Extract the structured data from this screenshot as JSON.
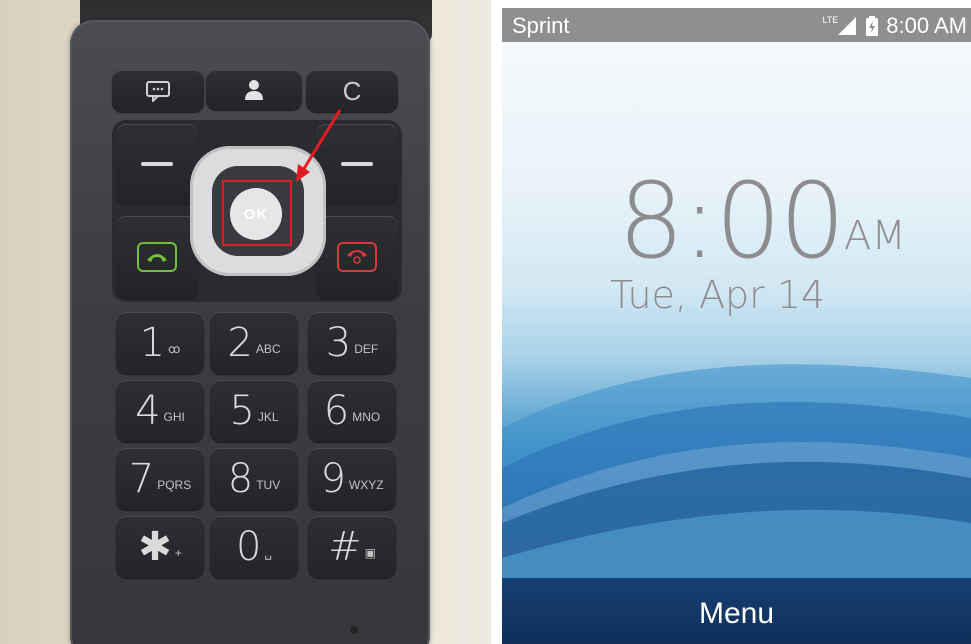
{
  "keypad": {
    "ok_label": "OK",
    "clear_label": "C",
    "keys": [
      {
        "digit": "1",
        "sub": "ꝏ",
        "name": "key-1"
      },
      {
        "digit": "2",
        "sub": "ABC",
        "name": "key-2"
      },
      {
        "digit": "3",
        "sub": "DEF",
        "name": "key-3"
      },
      {
        "digit": "4",
        "sub": "GHI",
        "name": "key-4"
      },
      {
        "digit": "5",
        "sub": "JKL",
        "name": "key-5"
      },
      {
        "digit": "6",
        "sub": "MNO",
        "name": "key-6"
      },
      {
        "digit": "7",
        "sub": "PQRS",
        "name": "key-7"
      },
      {
        "digit": "8",
        "sub": "TUV",
        "name": "key-8"
      },
      {
        "digit": "9",
        "sub": "WXYZ",
        "name": "key-9"
      },
      {
        "digit": "✱",
        "sub": "+",
        "name": "key-star"
      },
      {
        "digit": "0",
        "sub": "␣",
        "name": "key-0"
      },
      {
        "digit": "#",
        "sub": "▣",
        "name": "key-hash"
      }
    ],
    "colors": {
      "call": "#6fc23a",
      "end": "#d93a36",
      "highlight": "#e21c23"
    }
  },
  "screen": {
    "status": {
      "carrier": "Sprint",
      "network": "LTE",
      "time": "8:00 AM"
    },
    "lock": {
      "time": "8:00",
      "ampm": "AM",
      "date": "Tue, Apr 14"
    },
    "menu_label": "Menu"
  }
}
